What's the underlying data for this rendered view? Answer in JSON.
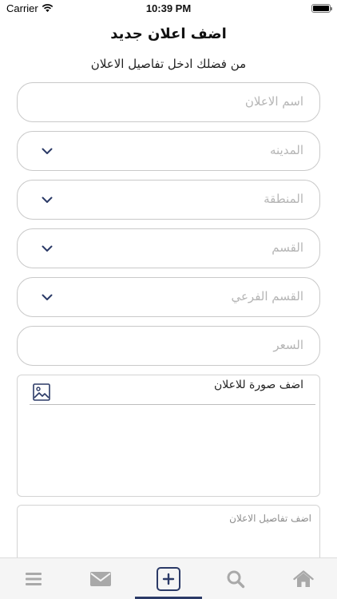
{
  "status_bar": {
    "carrier": "Carrier",
    "time": "10:39 PM"
  },
  "header": {
    "title": "اضف اعلان جديد",
    "subtitle": "من فضلك ادخل تفاصيل الاعلان"
  },
  "form": {
    "ad_name": {
      "placeholder": "اسم الاعلان",
      "value": ""
    },
    "city": {
      "placeholder": "المدينه",
      "value": ""
    },
    "region": {
      "placeholder": "المنطقة",
      "value": ""
    },
    "category": {
      "placeholder": "القسم",
      "value": ""
    },
    "subcategory": {
      "placeholder": "القسم الفرعي",
      "value": ""
    },
    "price": {
      "placeholder": "السعر",
      "value": ""
    },
    "image": {
      "label": "اضف صورة للاعلان"
    },
    "details": {
      "placeholder": "اضف تفاصيل الاعلان",
      "value": ""
    }
  },
  "tab_bar": {
    "active": "add",
    "tabs": [
      {
        "id": "menu",
        "icon": "menu-icon"
      },
      {
        "id": "messages",
        "icon": "envelope-icon"
      },
      {
        "id": "add",
        "icon": "add-icon"
      },
      {
        "id": "search",
        "icon": "search-icon"
      },
      {
        "id": "home",
        "icon": "home-icon"
      }
    ]
  },
  "colors": {
    "accent": "#2b3a67",
    "inactive_icon": "#a9a9a9",
    "placeholder": "#b5b5b5",
    "border": "#c9c9c9"
  }
}
